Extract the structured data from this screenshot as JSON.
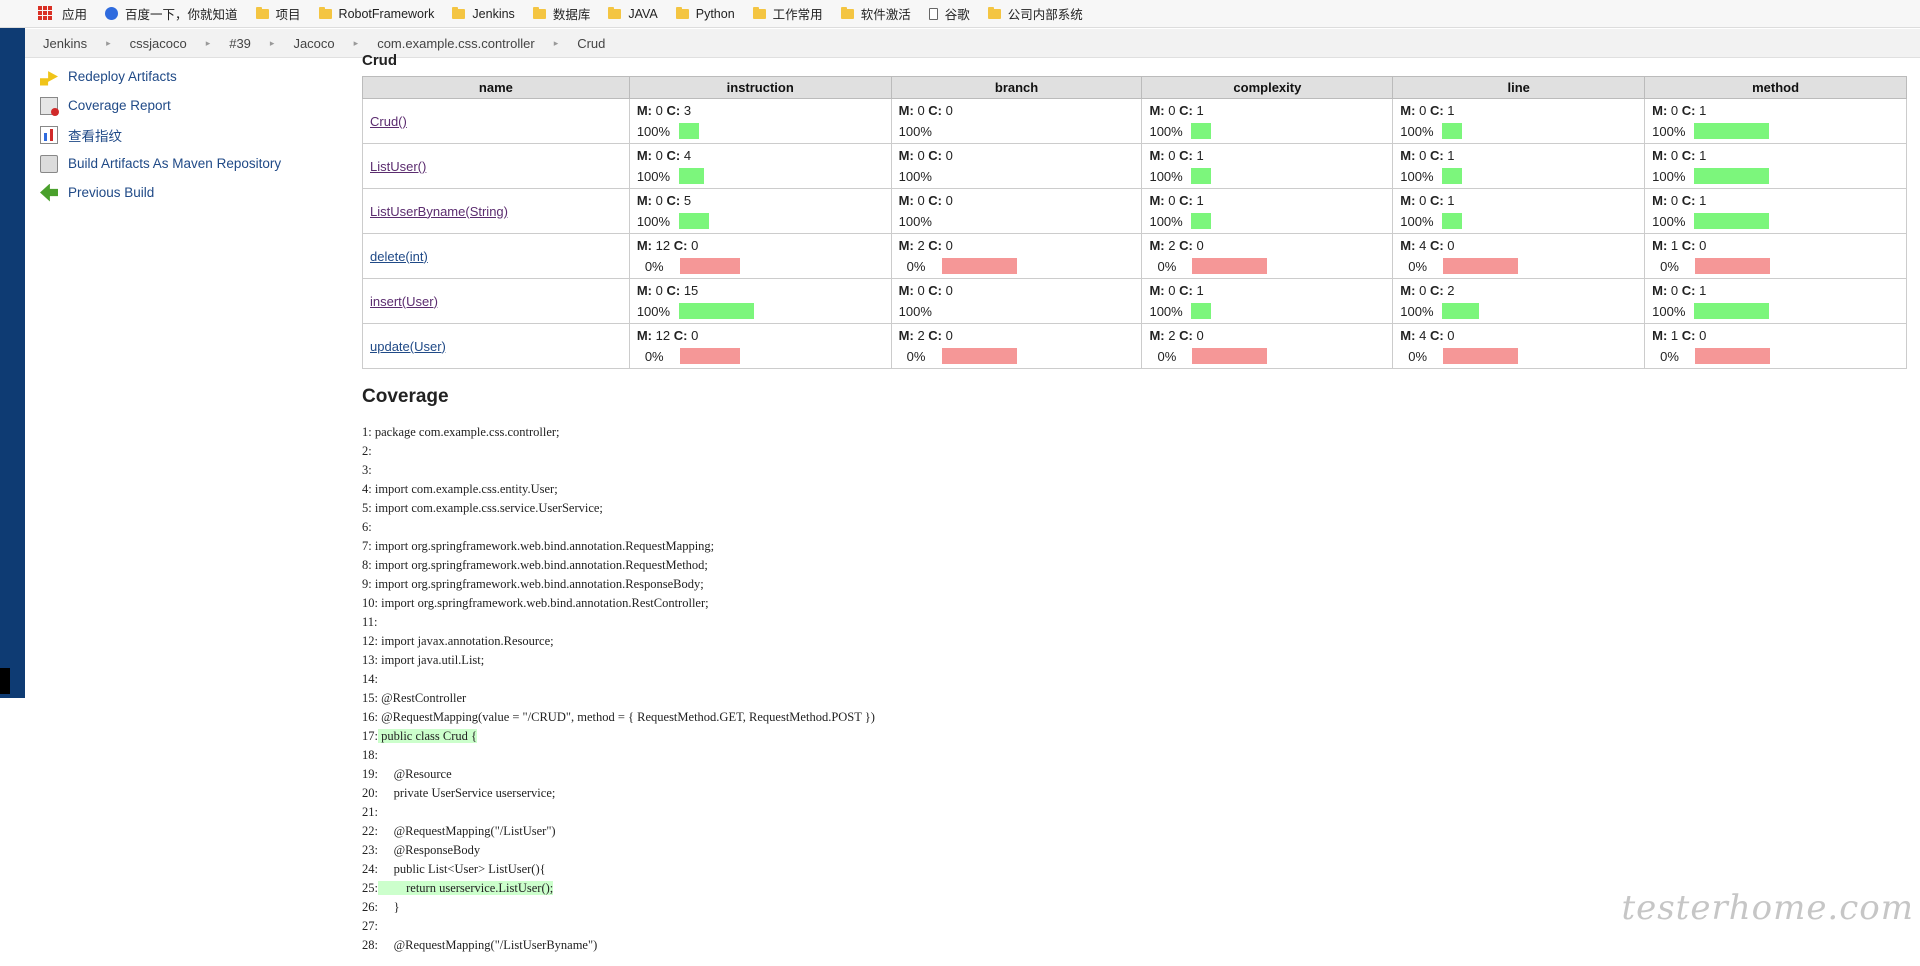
{
  "bookmarks": {
    "apps": "应用",
    "items": [
      {
        "label": "百度一下，你就知道",
        "icon": "paw-icon"
      },
      {
        "label": "项目",
        "icon": "folder-icon"
      },
      {
        "label": "RobotFramework",
        "icon": "folder-icon"
      },
      {
        "label": "Jenkins",
        "icon": "folder-icon"
      },
      {
        "label": "数据库",
        "icon": "folder-icon"
      },
      {
        "label": "JAVA",
        "icon": "folder-icon"
      },
      {
        "label": "Python",
        "icon": "folder-icon"
      },
      {
        "label": "工作常用",
        "icon": "folder-icon"
      },
      {
        "label": "软件激活",
        "icon": "folder-icon"
      },
      {
        "label": "谷歌",
        "icon": "page-icon"
      },
      {
        "label": "公司内部系统",
        "icon": "folder-icon"
      }
    ]
  },
  "breadcrumb": [
    "Jenkins",
    "cssjacoco",
    "#39",
    "Jacoco",
    "com.example.css.controller",
    "Crud"
  ],
  "sidebar": {
    "items": [
      {
        "label": "Redeploy Artifacts",
        "icon": "redeploy-icon"
      },
      {
        "label": "Coverage Report",
        "icon": "coverage-report-icon"
      },
      {
        "label": "查看指纹",
        "icon": "fingerprint-chart-icon"
      },
      {
        "label": "Build Artifacts As Maven Repository",
        "icon": "maven-repository-icon"
      },
      {
        "label": "Previous Build",
        "icon": "previous-build-icon"
      }
    ]
  },
  "crud": {
    "title": "Crud",
    "columns": [
      "name",
      "instruction",
      "branch",
      "complexity",
      "line",
      "method"
    ],
    "m_label": "M:",
    "c_label": "C:",
    "rows": [
      {
        "name": "Crud()",
        "link_color": "purple",
        "cells": [
          {
            "m": "0",
            "c": "3",
            "pct": "100%",
            "ratio": 1
          },
          {
            "m": "0",
            "c": "0",
            "pct": "100%",
            "ratio": null
          },
          {
            "m": "0",
            "c": "1",
            "pct": "100%",
            "ratio": 1
          },
          {
            "m": "0",
            "c": "1",
            "pct": "100%",
            "ratio": 1
          },
          {
            "m": "0",
            "c": "1",
            "pct": "100%",
            "ratio": 1
          }
        ]
      },
      {
        "name": "ListUser()",
        "link_color": "purple",
        "cells": [
          {
            "m": "0",
            "c": "4",
            "pct": "100%",
            "ratio": 1
          },
          {
            "m": "0",
            "c": "0",
            "pct": "100%",
            "ratio": null
          },
          {
            "m": "0",
            "c": "1",
            "pct": "100%",
            "ratio": 1
          },
          {
            "m": "0",
            "c": "1",
            "pct": "100%",
            "ratio": 1
          },
          {
            "m": "0",
            "c": "1",
            "pct": "100%",
            "ratio": 1
          }
        ]
      },
      {
        "name": "ListUserByname(String)",
        "link_color": "purple",
        "cells": [
          {
            "m": "0",
            "c": "5",
            "pct": "100%",
            "ratio": 1
          },
          {
            "m": "0",
            "c": "0",
            "pct": "100%",
            "ratio": null
          },
          {
            "m": "0",
            "c": "1",
            "pct": "100%",
            "ratio": 1
          },
          {
            "m": "0",
            "c": "1",
            "pct": "100%",
            "ratio": 1
          },
          {
            "m": "0",
            "c": "1",
            "pct": "100%",
            "ratio": 1
          }
        ]
      },
      {
        "name": "delete(int)",
        "link_color": "blue",
        "cells": [
          {
            "m": "12",
            "c": "0",
            "pct": "0%",
            "ratio": 0
          },
          {
            "m": "2",
            "c": "0",
            "pct": "0%",
            "ratio": 0
          },
          {
            "m": "2",
            "c": "0",
            "pct": "0%",
            "ratio": 0
          },
          {
            "m": "4",
            "c": "0",
            "pct": "0%",
            "ratio": 0
          },
          {
            "m": "1",
            "c": "0",
            "pct": "0%",
            "ratio": 0
          }
        ]
      },
      {
        "name": "insert(User)",
        "link_color": "purple",
        "cells": [
          {
            "m": "0",
            "c": "15",
            "pct": "100%",
            "ratio": 1
          },
          {
            "m": "0",
            "c": "0",
            "pct": "100%",
            "ratio": null
          },
          {
            "m": "0",
            "c": "1",
            "pct": "100%",
            "ratio": 1
          },
          {
            "m": "0",
            "c": "2",
            "pct": "100%",
            "ratio": 1
          },
          {
            "m": "0",
            "c": "1",
            "pct": "100%",
            "ratio": 1
          }
        ]
      },
      {
        "name": "update(User)",
        "link_color": "blue",
        "cells": [
          {
            "m": "12",
            "c": "0",
            "pct": "0%",
            "ratio": 0
          },
          {
            "m": "2",
            "c": "0",
            "pct": "0%",
            "ratio": 0
          },
          {
            "m": "2",
            "c": "0",
            "pct": "0%",
            "ratio": 0
          },
          {
            "m": "4",
            "c": "0",
            "pct": "0%",
            "ratio": 0
          },
          {
            "m": "1",
            "c": "0",
            "pct": "0%",
            "ratio": 0
          }
        ]
      }
    ]
  },
  "coverage": {
    "title": "Coverage",
    "lines": [
      {
        "n": "1:",
        "code": " package com.example.css.controller;",
        "hl": false
      },
      {
        "n": "2:",
        "code": "",
        "hl": false
      },
      {
        "n": "3:",
        "code": "",
        "hl": false
      },
      {
        "n": "4:",
        "code": " import com.example.css.entity.User;",
        "hl": false
      },
      {
        "n": "5:",
        "code": " import com.example.css.service.UserService;",
        "hl": false
      },
      {
        "n": "6:",
        "code": "",
        "hl": false
      },
      {
        "n": "7:",
        "code": " import org.springframework.web.bind.annotation.RequestMapping;",
        "hl": false
      },
      {
        "n": "8:",
        "code": " import org.springframework.web.bind.annotation.RequestMethod;",
        "hl": false
      },
      {
        "n": "9:",
        "code": " import org.springframework.web.bind.annotation.ResponseBody;",
        "hl": false
      },
      {
        "n": "10:",
        "code": " import org.springframework.web.bind.annotation.RestController;",
        "hl": false
      },
      {
        "n": "11:",
        "code": "",
        "hl": false
      },
      {
        "n": "12:",
        "code": " import javax.annotation.Resource;",
        "hl": false
      },
      {
        "n": "13:",
        "code": " import java.util.List;",
        "hl": false
      },
      {
        "n": "14:",
        "code": "",
        "hl": false
      },
      {
        "n": "15:",
        "code": " @RestController",
        "hl": false
      },
      {
        "n": "16:",
        "code": " @RequestMapping(value = \"/CRUD\", method = { RequestMethod.GET, RequestMethod.POST })",
        "hl": false
      },
      {
        "n": "17:",
        "code": " public class Crud {",
        "hl": true
      },
      {
        "n": "18:",
        "code": "",
        "hl": false
      },
      {
        "n": "19:",
        "code": "     @Resource",
        "hl": false
      },
      {
        "n": "20:",
        "code": "     private UserService userservice;",
        "hl": false
      },
      {
        "n": "21:",
        "code": "",
        "hl": false
      },
      {
        "n": "22:",
        "code": "     @RequestMapping(\"/ListUser\")",
        "hl": false
      },
      {
        "n": "23:",
        "code": "     @ResponseBody",
        "hl": false
      },
      {
        "n": "24:",
        "code": "     public List<User> ListUser(){",
        "hl": false
      },
      {
        "n": "25:",
        "code": "         return userservice.ListUser();",
        "hl": true
      },
      {
        "n": "26:",
        "code": "     }",
        "hl": false
      },
      {
        "n": "27:",
        "code": "",
        "hl": false
      },
      {
        "n": "28:",
        "code": "     @RequestMapping(\"/ListUserByname\")",
        "hl": false
      }
    ]
  },
  "watermark": "testerhome.com",
  "colors": {
    "covered": "#7cf67c",
    "missed": "#f59797",
    "highlight": "#ccffcc",
    "link_blue": "#204a87",
    "link_purple": "#5b2c6f"
  }
}
